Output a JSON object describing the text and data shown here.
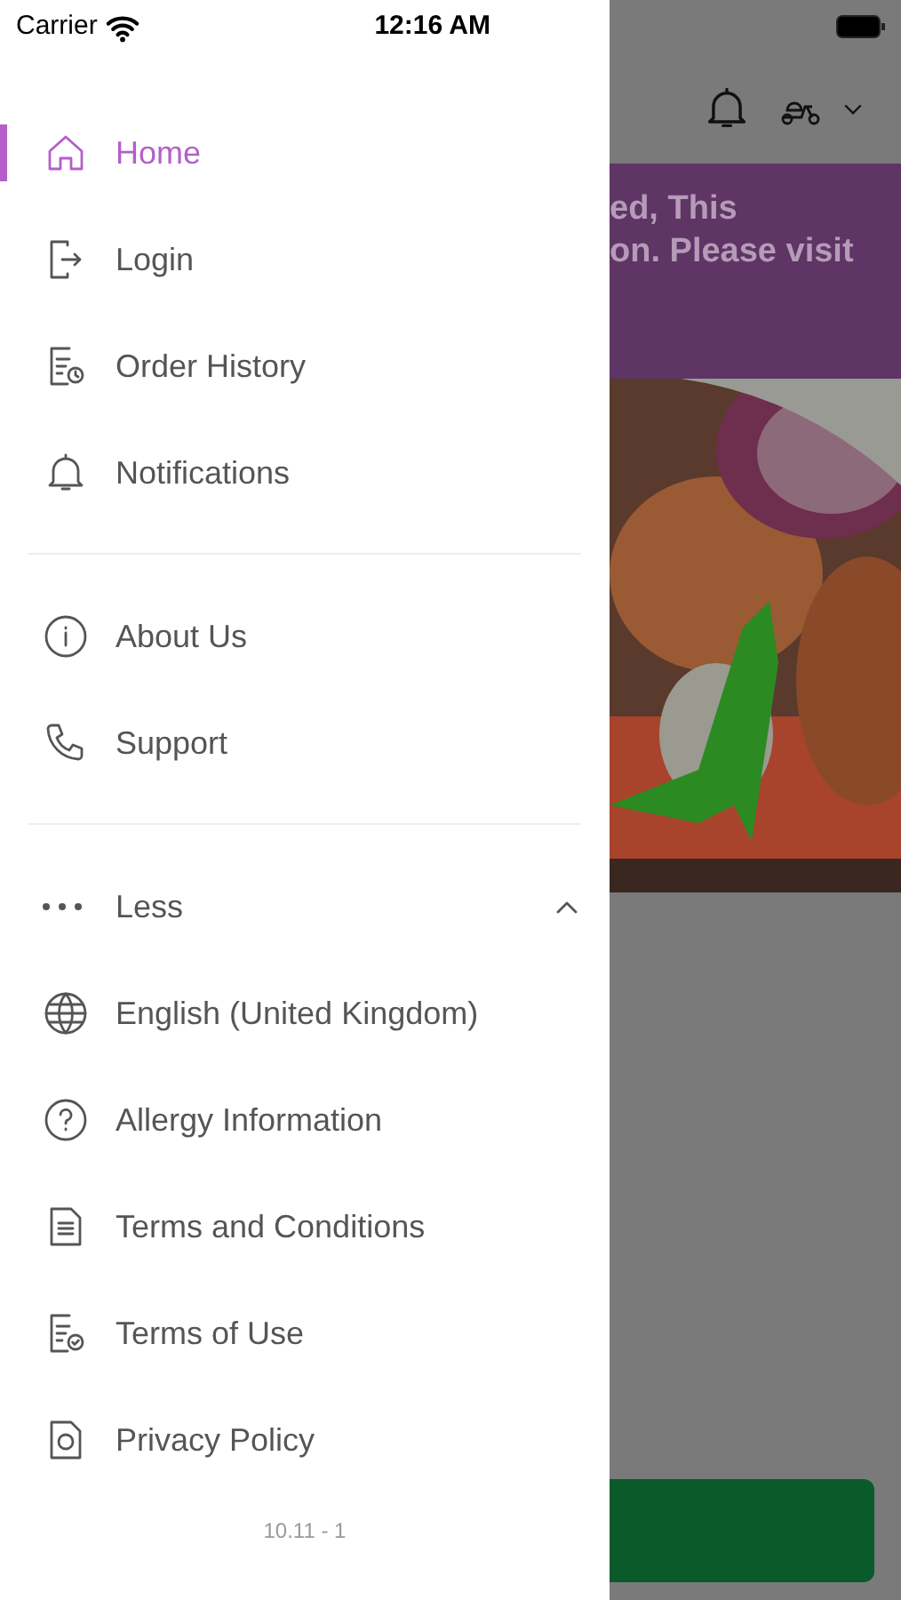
{
  "status_bar": {
    "carrier": "Carrier",
    "time": "12:16 AM"
  },
  "menu": {
    "sections": [
      {
        "items": [
          {
            "label": "Home",
            "selected": true
          },
          {
            "label": "Login",
            "selected": false
          },
          {
            "label": "Order History",
            "selected": false
          },
          {
            "label": "Notifications",
            "selected": false
          }
        ]
      },
      {
        "items": [
          {
            "label": "About Us",
            "selected": false
          },
          {
            "label": "Support",
            "selected": false
          }
        ]
      }
    ],
    "more_toggle": {
      "label": "Less",
      "expanded": true
    },
    "more_items": [
      {
        "label": "English (United Kingdom)",
        "selected": false
      },
      {
        "label": "Allergy Information",
        "selected": false
      },
      {
        "label": "Terms and Conditions",
        "selected": false
      },
      {
        "label": "Terms of Use",
        "selected": false
      },
      {
        "label": "Privacy Policy",
        "selected": false
      }
    ],
    "version": "10.11 - 1"
  },
  "background": {
    "banner_lines": [
      "ed, This",
      "on. Please visit"
    ]
  }
}
